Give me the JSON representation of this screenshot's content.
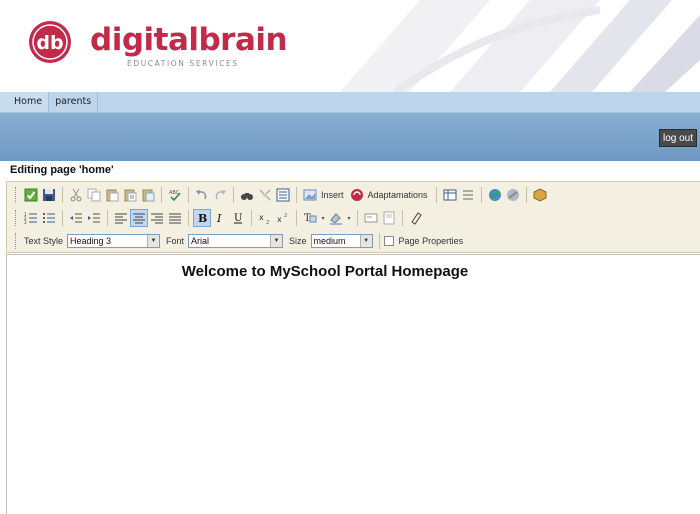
{
  "brand": {
    "logo_mark": "db",
    "name": "digitalbrain",
    "tagline": "EDUCATION SERVICES",
    "color": "#c22a4a"
  },
  "nav": {
    "tabs": [
      {
        "label": "Home",
        "active": true
      },
      {
        "label": "parents",
        "active": false
      }
    ]
  },
  "header_bar": {
    "logout_label": "log out"
  },
  "editor": {
    "title": "Editing page 'home'",
    "toolbar": {
      "insert_label": "Insert",
      "adaptamations_label": "Adaptamations",
      "text_style_label": "Text Style",
      "text_style_value": "Heading 3",
      "font_label": "Font",
      "font_value": "Arial",
      "size_label": "Size",
      "size_value": "medium",
      "page_properties_label": "Page Properties"
    },
    "content_heading": "Welcome to MySchool Portal Homepage"
  }
}
